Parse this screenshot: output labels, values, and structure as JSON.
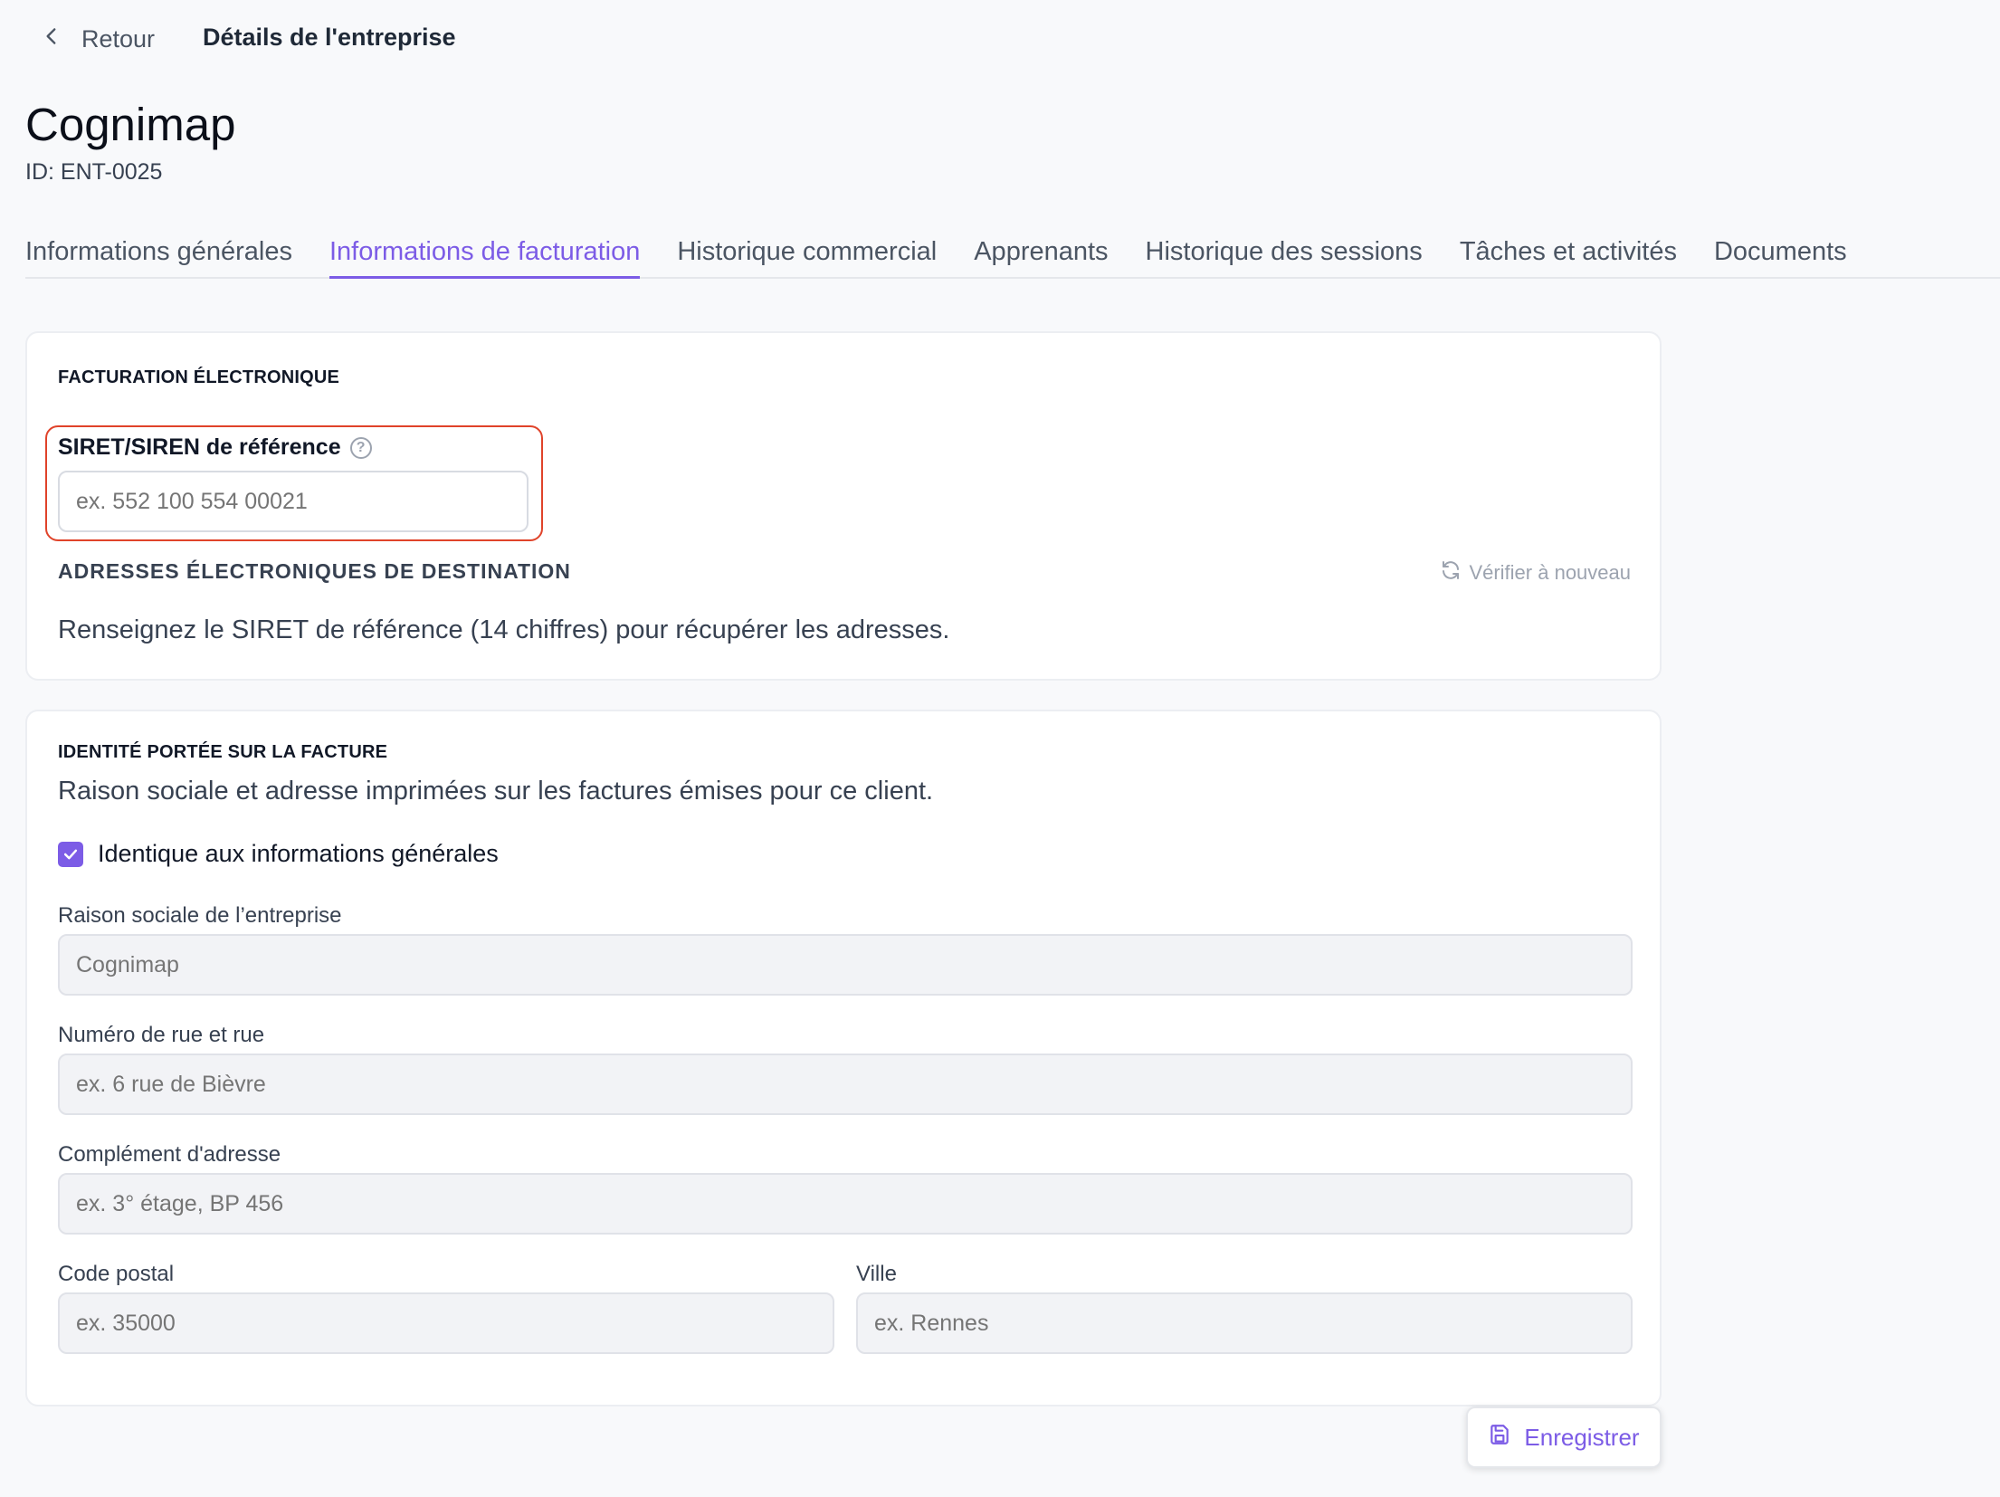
{
  "header": {
    "back_label": "Retour",
    "breadcrumb_title": "Détails de l'entreprise"
  },
  "company": {
    "name": "Cognimap",
    "id": "ID: ENT-0025"
  },
  "tabs": [
    {
      "label": "Informations générales",
      "active": false
    },
    {
      "label": "Informations de facturation",
      "active": true
    },
    {
      "label": "Historique commercial",
      "active": false
    },
    {
      "label": "Apprenants",
      "active": false
    },
    {
      "label": "Historique des sessions",
      "active": false
    },
    {
      "label": "Tâches et activités",
      "active": false
    },
    {
      "label": "Documents",
      "active": false
    }
  ],
  "einvoice": {
    "section_title": "FACTURATION ÉLECTRONIQUE",
    "siret_label": "SIRET/SIREN de référence",
    "siret_placeholder": "ex. 552 100 554 00021",
    "dest_title": "ADRESSES ÉLECTRONIQUES DE DESTINATION",
    "verify_label": "Vérifier à nouveau",
    "help_text": "Renseignez le SIRET de référence (14 chiffres) pour récupérer les adresses."
  },
  "identity": {
    "section_title": "IDENTITÉ PORTÉE SUR LA FACTURE",
    "description": "Raison sociale et adresse imprimées sur les factures émises pour ce client.",
    "same_as_general_label": "Identique aux informations générales",
    "same_as_general_checked": true,
    "company_name_label": "Raison sociale de l’entreprise",
    "company_name_value": "Cognimap",
    "street_label": "Numéro de rue et rue",
    "street_placeholder": "ex. 6 rue de Bièvre",
    "complement_label": "Complément d'adresse",
    "complement_placeholder": "ex. 3° étage, BP 456",
    "postal_label": "Code postal",
    "postal_placeholder": "ex. 35000",
    "city_label": "Ville",
    "city_placeholder": "ex. Rennes"
  },
  "actions": {
    "save_label": "Enregistrer"
  },
  "colors": {
    "accent": "#7c5ce6",
    "highlight_border": "#e0432a"
  }
}
